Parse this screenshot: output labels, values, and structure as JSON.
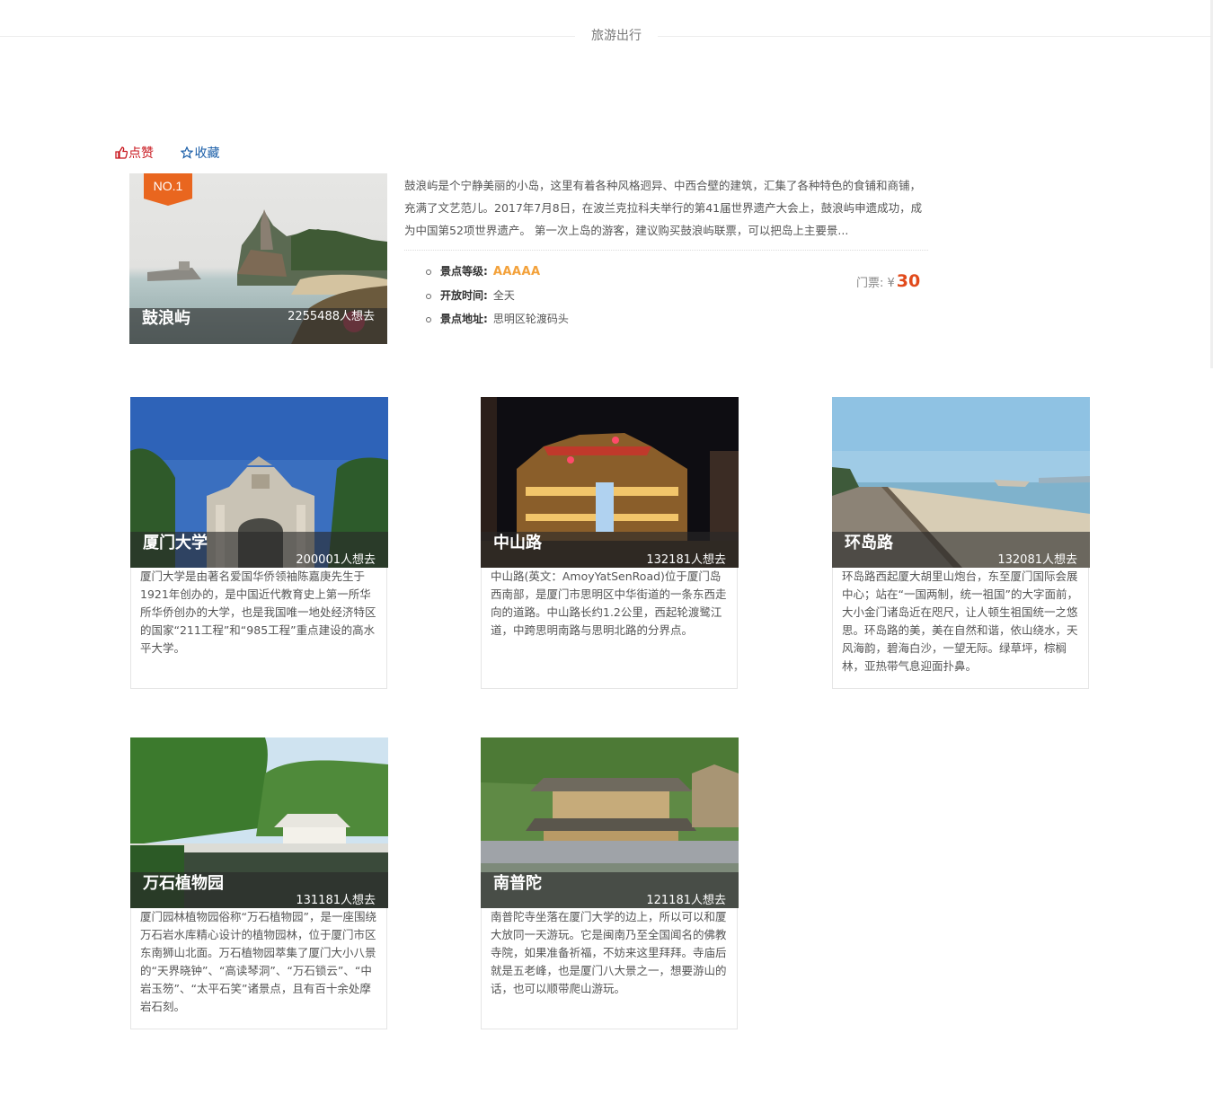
{
  "section_title": "旅游出行",
  "actions": {
    "like": "点赞",
    "favorite": "收藏"
  },
  "featured": {
    "badge": "NO.1",
    "name": "鼓浪屿",
    "count": "2255488人想去",
    "description": "鼓浪屿是个宁静美丽的小岛，这里有着各种风格迥异、中西合壁的建筑，汇集了各种特色的食铺和商铺，充满了文艺范儿。2017年7月8日，在波兰克拉科夫举行的第41届世界遗产大会上，鼓浪屿申遗成功，成为中国第52项世界遗产。 第一次上岛的游客，建议购买鼓浪屿联票，可以把岛上主要景...",
    "info": [
      {
        "label": "景点等级:",
        "value": "AAAAA"
      },
      {
        "label": "开放时间:",
        "value": "全天"
      },
      {
        "label": "景点地址:",
        "value": "思明区轮渡码头"
      }
    ],
    "price_label": "门票: ¥",
    "price": "30"
  },
  "cards": [
    {
      "name": "厦门大学",
      "count": "200001人想去",
      "description": "厦门大学是由著名爱国华侨领袖陈嘉庚先生于1921年创办的，是中国近代教育史上第一所华所华侨创办的大学，也是我国唯一地处经济特区的国家“211工程”和“985工程”重点建设的高水平大学。"
    },
    {
      "name": "中山路",
      "count": "132181人想去",
      "description": "中山路(英文：AmoyYatSenRoad)位于厦门岛西南部，是厦门市思明区中华街道的一条东西走向的道路。中山路长约1.2公里，西起轮渡鹭江道，中跨思明南路与思明北路的分界点。"
    },
    {
      "name": "环岛路",
      "count": "132081人想去",
      "description": "环岛路西起厦大胡里山炮台，东至厦门国际会展中心；站在“一国两制，统一祖国”的大字面前，大小金门诸岛近在咫尺，让人顿生祖国统一之悠思。环岛路的美，美在自然和谐，依山绕水，天风海韵，碧海白沙，一望无际。绿草坪，棕榈林，亚热带气息迎面扑鼻。"
    },
    {
      "name": "万石植物园",
      "count": "131181人想去",
      "description": "厦门园林植物园俗称“万石植物园”，是一座围绕万石岩水库精心设计的植物园林，位于厦门市区东南狮山北面。万石植物园萃集了厦门大小八景的“天界晓钟”、“高读琴洞”、“万石锁云”、“中岩玉笏”、“太平石笑”诸景点，且有百十余处摩岩石刻。"
    },
    {
      "name": "南普陀",
      "count": "121181人想去",
      "description": "南普陀寺坐落在厦门大学的边上，所以可以和厦大放同一天游玩。它是闽南乃至全国闻名的佛教寺院，如果准备祈福，不妨来这里拜拜。寺庙后就是五老峰，也是厦门八大景之一，想要游山的话，也可以顺带爬山游玩。"
    }
  ]
}
